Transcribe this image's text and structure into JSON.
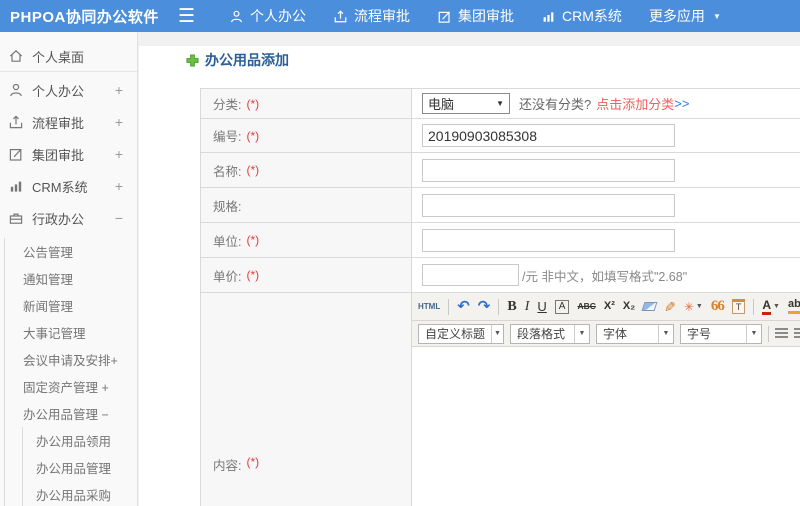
{
  "header": {
    "logo": "PHPOA协同办公软件",
    "nav": [
      {
        "label": "个人办公"
      },
      {
        "label": "流程审批"
      },
      {
        "label": "集团审批"
      },
      {
        "label": "CRM系统"
      },
      {
        "label": "更多应用"
      }
    ]
  },
  "sidebar": {
    "items": [
      {
        "label": "个人桌面",
        "expander": ""
      },
      {
        "label": "个人办公",
        "expander": "+"
      },
      {
        "label": "流程审批",
        "expander": "+"
      },
      {
        "label": "集团审批",
        "expander": "+"
      },
      {
        "label": "CRM系统",
        "expander": "+"
      },
      {
        "label": "行政办公",
        "expander": "−"
      }
    ],
    "submenu": [
      {
        "label": "公告管理"
      },
      {
        "label": "通知管理"
      },
      {
        "label": "新闻管理"
      },
      {
        "label": "大事记管理"
      },
      {
        "label": "会议申请及安排+"
      },
      {
        "label": "固定资产管理 +"
      },
      {
        "label": "办公用品管理 −"
      }
    ],
    "subsubmenu": [
      {
        "label": "办公用品领用"
      },
      {
        "label": "办公用品管理"
      },
      {
        "label": "办公用品采购"
      }
    ]
  },
  "main": {
    "title": "办公用品添加",
    "form": {
      "category": {
        "label": "分类:",
        "required": "(*)",
        "value": "电脑",
        "hint": "还没有分类?",
        "link": "点击添加分类",
        "link_arrows": ">>"
      },
      "code": {
        "label": "编号:",
        "required": "(*)",
        "value": "20190903085308"
      },
      "name": {
        "label": "名称:",
        "required": "(*)",
        "value": ""
      },
      "spec": {
        "label": "规格:",
        "value": ""
      },
      "unit": {
        "label": "单位:",
        "required": "(*)",
        "value": ""
      },
      "price": {
        "label": "单价:",
        "required": "(*)",
        "value": "",
        "suffix": "/元 非中文，如填写格式\"2.68\""
      },
      "content": {
        "label": "内容:",
        "required": "(*)"
      }
    }
  },
  "editor": {
    "toolbar": {
      "html": "HTML",
      "undo": "↶",
      "redo": "↷",
      "bold": "B",
      "italic": "I",
      "underline": "U",
      "boxed_a": "A",
      "strike": "ABC",
      "sup": "X²",
      "subscript": "X₂",
      "quote": "66",
      "paste": "T",
      "font_color": "A",
      "highlight": "ab",
      "link": "∞"
    },
    "dropdowns": [
      {
        "label": "自定义标题"
      },
      {
        "label": "段落格式"
      },
      {
        "label": "字体"
      },
      {
        "label": "字号"
      }
    ]
  },
  "colors": {
    "header_bg": "#4b8edb",
    "required_red": "#e43c3c",
    "category_link_red": "#f0605f",
    "category_arrows_blue": "#2f7cd0",
    "title_blue": "#2a5f96"
  }
}
